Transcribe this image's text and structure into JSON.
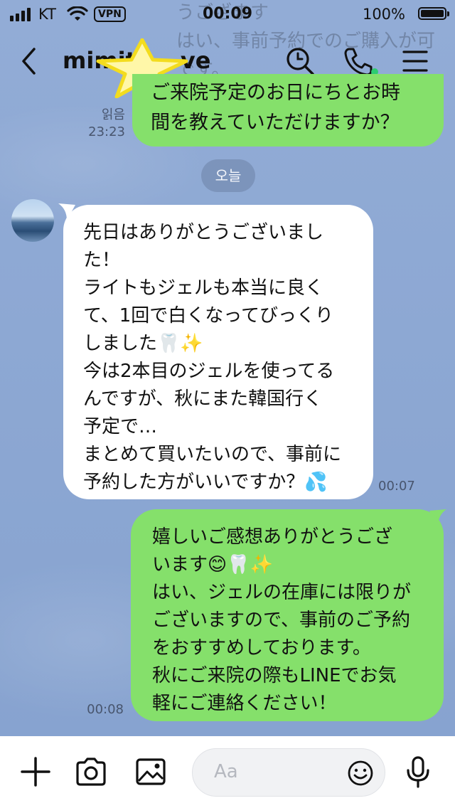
{
  "status_bar": {
    "carrier": "KT",
    "vpn": "VPN",
    "time": "00:09",
    "battery": "100%"
  },
  "header": {
    "title": "mimit",
    "title_suffix": "ve",
    "icons": [
      "back-icon",
      "search-icon",
      "phone-icon",
      "menu-icon"
    ]
  },
  "ghost_text": "うござます\nはい、事前予約でのご購入が可\nです。",
  "messages": {
    "prev_out": {
      "text": "ご来院予定のお日にちとお時\n間を教えていただけますか？",
      "read": "읽음",
      "time": "23:23"
    },
    "date_divider": "오늘",
    "incoming": {
      "text": "先日はありがとうございまし\nた！\nライトもジェルも本当に良く\nて、1回で白くなってびっくり\nしました🦷✨\n今は2本目のジェルを使ってる\nんですが、秋にまた韓国行く\n予定で…\nまとめて買いたいので、事前に\n予約した方がいいですか？💦",
      "time": "00:07"
    },
    "reply": {
      "text": "嬉しいご感想ありがとうござ\nいます😊🦷✨\nはい、ジェルの在庫には限りが\nございますので、事前のご予約\nをおすすめしております。\n秋にご来院の際もLINEでお気\n軽にご連絡ください！",
      "time": "00:08"
    }
  },
  "input_bar": {
    "placeholder": "Aa",
    "icons": [
      "plus-icon",
      "camera-icon",
      "image-icon",
      "emoji-icon",
      "microphone-icon"
    ]
  },
  "colors": {
    "background": "#8aa6d2",
    "outgoing_bubble": "#85e06b",
    "incoming_bubble": "#ffffff",
    "online_dot": "#2ecc71",
    "star": "#fff176"
  }
}
